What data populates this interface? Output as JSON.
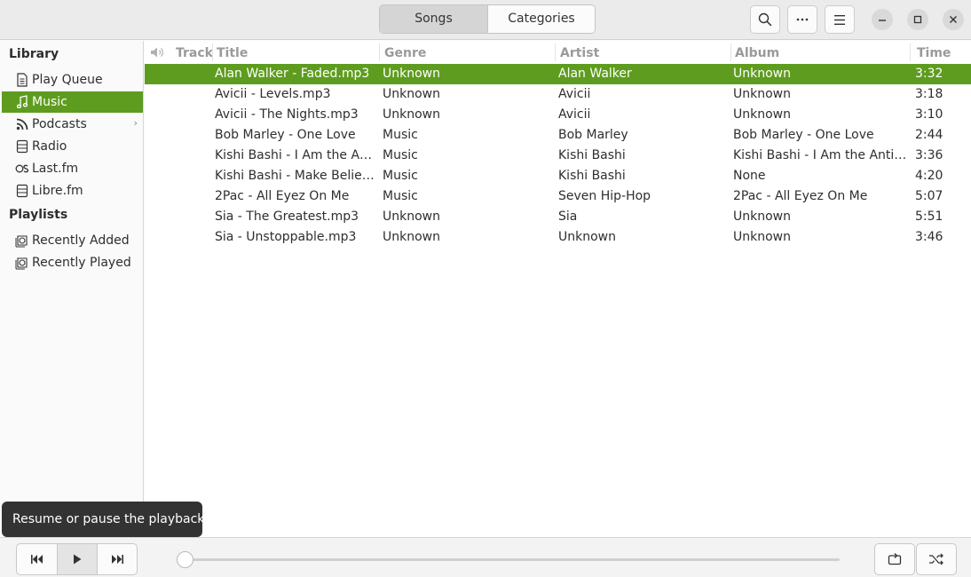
{
  "header": {
    "tabs": [
      {
        "label": "Songs",
        "active": true
      },
      {
        "label": "Categories",
        "active": false
      }
    ],
    "buttons": [
      "search-icon",
      "more-icon",
      "menu-icon"
    ],
    "window_controls": [
      "minimize-icon",
      "maximize-icon",
      "close-icon"
    ]
  },
  "sidebar": {
    "library_heading": "Library",
    "library_items": [
      {
        "label": "Play Queue",
        "icon": "queue-icon"
      },
      {
        "label": "Music",
        "icon": "music-note-icon",
        "selected": true
      },
      {
        "label": "Podcasts",
        "icon": "rss-icon",
        "has_chevron": true
      },
      {
        "label": "Radio",
        "icon": "radio-icon"
      },
      {
        "label": "Last.fm",
        "icon": "lastfm-icon"
      },
      {
        "label": "Libre.fm",
        "icon": "librefm-icon"
      }
    ],
    "playlists_heading": "Playlists",
    "playlist_items": [
      {
        "label": "Recently Added",
        "icon": "playlist-icon"
      },
      {
        "label": "Recently Played",
        "icon": "playlist-icon"
      }
    ]
  },
  "songs": {
    "columns": {
      "track": "Track",
      "title": "Title",
      "genre": "Genre",
      "artist": "Artist",
      "album": "Album",
      "time": "Time"
    },
    "rows": [
      {
        "title": "Alan Walker - Faded.mp3",
        "genre": "Unknown",
        "artist": "Alan Walker",
        "album": "Unknown",
        "time": "3:32",
        "selected": true
      },
      {
        "title": "Avicii - Levels.mp3",
        "genre": "Unknown",
        "artist": "Avicii",
        "album": "Unknown",
        "time": "3:18"
      },
      {
        "title": "Avicii - The Nights.mp3",
        "genre": "Unknown",
        "artist": "Avicii",
        "album": "Unknown",
        "time": "3:10"
      },
      {
        "title": "Bob Marley - One Love",
        "genre": "Music",
        "artist": "Bob Marley",
        "album": "Bob Marley - One Love",
        "time": "2:44"
      },
      {
        "title": "Kishi Bashi - I Am the Ant…",
        "genre": "Music",
        "artist": "Kishi Bashi",
        "album": "Kishi Bashi - I Am the Antich…",
        "time": "3:36"
      },
      {
        "title": "Kishi Bashi - Make Believ…",
        "genre": "Music",
        "artist": "Kishi Bashi",
        "album": "None",
        "time": "4:20"
      },
      {
        "title": "2Pac - All Eyez On Me",
        "genre": "Music",
        "artist": "Seven Hip-Hop",
        "album": "2Pac - All Eyez On Me",
        "time": "5:07"
      },
      {
        "title": "Sia - The Greatest.mp3",
        "genre": "Unknown",
        "artist": "Sia",
        "album": "Unknown",
        "time": "5:51"
      },
      {
        "title": "Sia - Unstoppable.mp3",
        "genre": "Unknown",
        "artist": "Unknown",
        "album": "Unknown",
        "time": "3:46"
      }
    ]
  },
  "tooltip": {
    "text": "Resume or pause the playback"
  },
  "player": {
    "progress": 0,
    "controls": [
      "previous-icon",
      "play-icon",
      "next-icon"
    ],
    "right_buttons": [
      "repeat-icon",
      "shuffle-icon"
    ]
  },
  "colors": {
    "accent": "#5e9c1f",
    "tooltip_bg": "#333333"
  }
}
